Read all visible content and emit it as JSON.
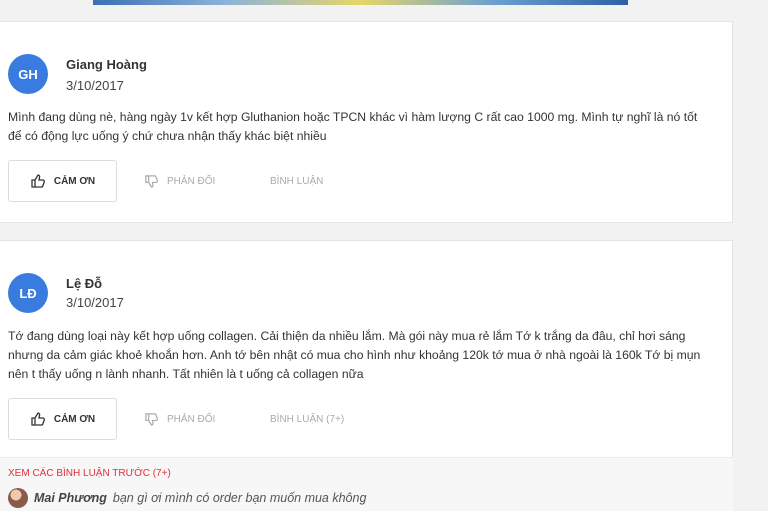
{
  "reviews": [
    {
      "avatar_initials": "GH",
      "author": "Giang Hoàng",
      "date": "3/10/2017",
      "text": "Mình đang dùng nè, hàng ngày 1v kết hợp Gluthanion hoặc TPCN khác vì hàm lượng C rất cao 1000 mg. Mình tự nghĩ là nó tốt để có động lực uống ý chứ chưa nhận thấy khác biệt nhiều",
      "thanks_label": "CẢM ƠN",
      "oppose_label": "PHẢN ĐỐI",
      "comment_label": "BÌNH LUẬN"
    },
    {
      "avatar_initials": "LĐ",
      "author": "Lệ Đỗ",
      "date": "3/10/2017",
      "text": "Tớ đang dùng loại này kết hợp uống collagen. Cải thiện da nhiều lắm. Mà gói này mua rẻ lắm Tớ k trắng da đâu, chỉ hơi sáng nhưng da cảm giác khoẻ khoắn hơn. Anh tớ bên nhật có mua cho hình như khoảng 120k tớ mua ở nhà ngoài là 160k Tớ bị mụn nên t thấy uống n lành nhanh. Tất nhiên là t uống cả collagen nữa",
      "thanks_label": "CẢM ƠN",
      "oppose_label": "PHẢN ĐỐI",
      "comment_label": "BÌNH LUẬN (7+)",
      "see_more_label": "XEM CÁC BÌNH LUẬN TRƯỚC (7+)",
      "comment": {
        "name": "Mai Phương",
        "text": "bạn gì ơi mình có order bạn muốn mua không"
      }
    }
  ],
  "colors": {
    "avatar": "#3a7be0",
    "link_red": "#e0303a"
  }
}
